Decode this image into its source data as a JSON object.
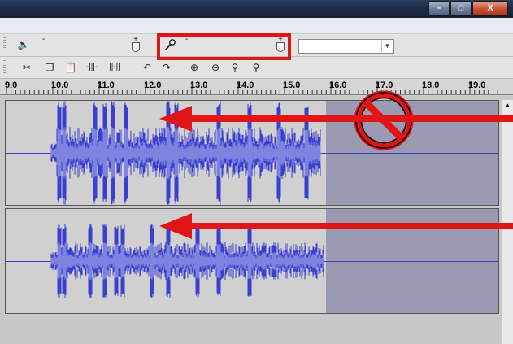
{
  "window": {
    "minimize_glyph": "–",
    "maximize_glyph": "□",
    "close_glyph": "X"
  },
  "toolbar": {
    "speaker_icon": "speaker-icon",
    "mic_icon": "microphone-icon",
    "playback_slider": {
      "min_label": "-",
      "max_label": "+",
      "level": 1.0
    },
    "record_slider": {
      "min_label": "-",
      "max_label": "+",
      "level": 1.0
    },
    "input_device_value": "",
    "edit_icons": [
      "scissors-icon",
      "copy-icon",
      "paste-icon",
      "trim-icon",
      "silence-icon",
      "undo-icon",
      "redo-icon",
      "zoom-in-icon",
      "zoom-out-icon",
      "fit-selection-icon",
      "fit-project-icon"
    ]
  },
  "ruler": {
    "labels": [
      "9.0",
      "10.0",
      "11.0",
      "12.0",
      "13.0",
      "14.0",
      "15.0",
      "16.0",
      "17.0",
      "18.0",
      "19.0"
    ]
  },
  "colors": {
    "waveform": "#3a3fcf",
    "waveform_rms": "#7f83e0",
    "annotation": "#e11515",
    "unselected_region": "#9a9bb3"
  },
  "annotations": {
    "no_symbol": "prohibited-icon",
    "arrows": 2,
    "highlight": "recording-level-slider"
  }
}
